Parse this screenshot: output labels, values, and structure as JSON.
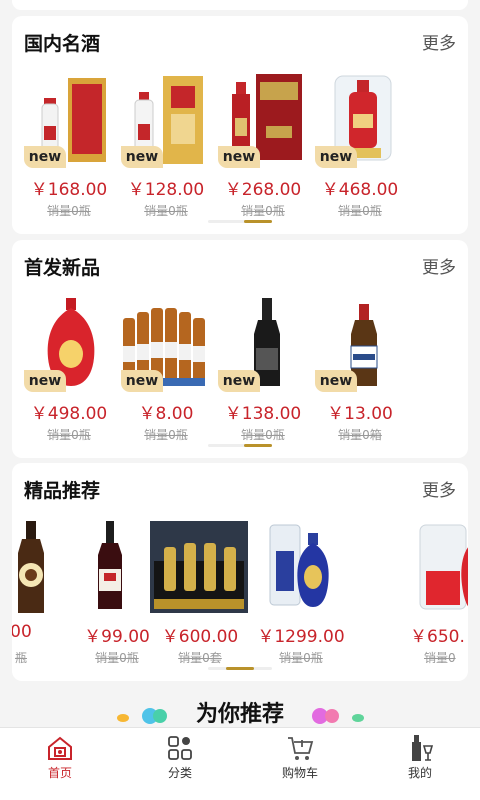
{
  "sections": [
    {
      "title": "国内名酒",
      "more": "更多",
      "items": [
        {
          "name": "red-gift-box-baijiu",
          "new": "new",
          "price": "￥168.00",
          "sold": "销量0瓶"
        },
        {
          "name": "gold-box-baijiu",
          "new": "new",
          "price": "￥128.00",
          "sold": "销量0瓶"
        },
        {
          "name": "red-gift-box-t8",
          "new": "new",
          "price": "￥268.00",
          "sold": "销量0瓶"
        },
        {
          "name": "glass-case-baijiu",
          "new": "new",
          "price": "￥468.00",
          "sold": "销量0瓶"
        }
      ]
    },
    {
      "title": "首发新品",
      "more": "更多",
      "items": [
        {
          "name": "red-lang-bottle",
          "new": "new",
          "price": "￥498.00",
          "sold": "销量0瓶"
        },
        {
          "name": "hoegaarden-six-pack",
          "new": "new",
          "price": "￥8.00",
          "sold": "销量0瓶"
        },
        {
          "name": "sparkling-wine-bottle",
          "new": "new",
          "price": "￥138.00",
          "sold": "销量0瓶"
        },
        {
          "name": "vedett-beer",
          "new": "new",
          "price": "￥13.00",
          "sold": "销量0箱"
        }
      ]
    },
    {
      "title": "精品推荐",
      "more": "更多",
      "items": [
        {
          "name": "franziskaner-beer",
          "price": "00",
          "sold": "瓶"
        },
        {
          "name": "red-wine-bottle",
          "price": "￥99.00",
          "sold": "销量0瓶"
        },
        {
          "name": "wine-gift-set",
          "price": "￥600.00",
          "sold": "销量0套"
        },
        {
          "name": "blue-lang-bottle",
          "price": "￥1299.00",
          "sold": "销量0瓶"
        },
        {
          "name": "red-glass-case-bottle",
          "price": "￥650.",
          "sold": "销量0"
        }
      ]
    }
  ],
  "recommend": {
    "title": "为你推荐"
  },
  "tabbar": [
    {
      "label": "首页",
      "icon": "home-icon",
      "active": true
    },
    {
      "label": "分类",
      "icon": "category-icon",
      "active": false
    },
    {
      "label": "购物车",
      "icon": "cart-icon",
      "active": false
    },
    {
      "label": "我的",
      "icon": "profile-icon",
      "active": false
    }
  ],
  "colors": {
    "accent": "#c8242b",
    "tag": "#f2dba8",
    "gold": "#b9922a"
  }
}
